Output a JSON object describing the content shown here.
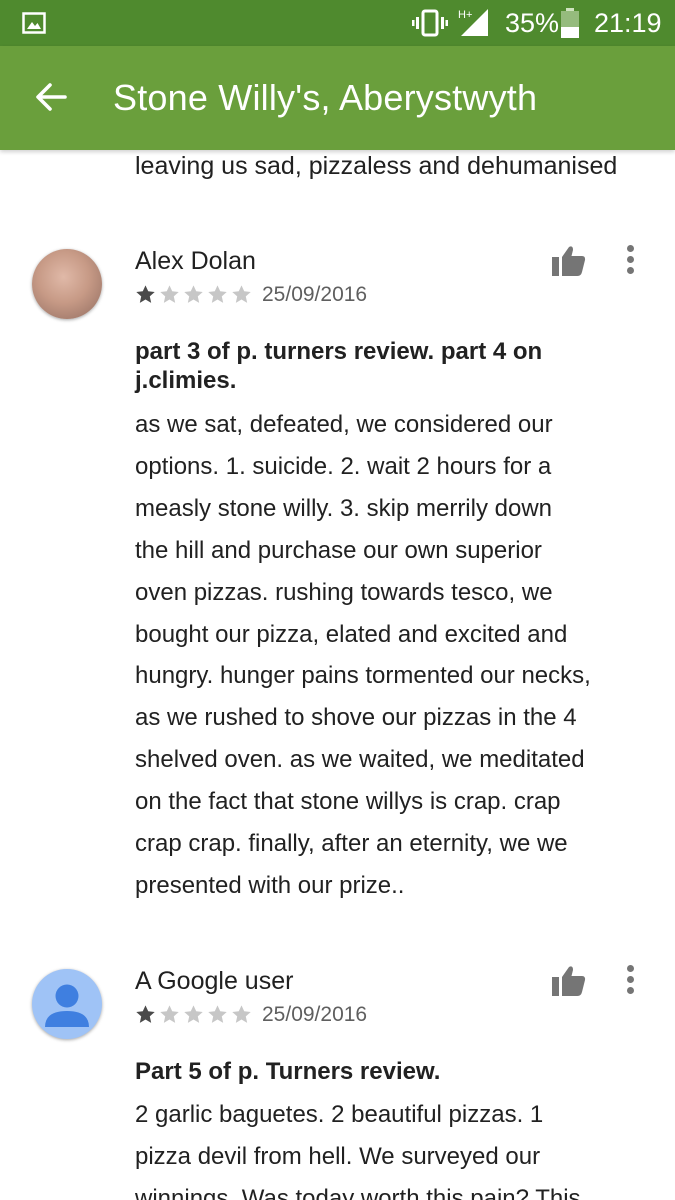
{
  "status_bar": {
    "network": "H+",
    "battery": "35%",
    "time": "21:19"
  },
  "app_bar": {
    "title": "Stone Willy's, Aberystwyth"
  },
  "previous_review_tail": "leaving us sad, pizzaless and dehumanised",
  "reviews": [
    {
      "author": "Alex Dolan",
      "rating": 1,
      "max_rating": 5,
      "date": "25/09/2016",
      "title_lines": [
        "part 3 of p. turners review. part 4 on",
        "j.climies."
      ],
      "body_lines": [
        "as we sat, defeated, we considered our",
        "options. 1. suicide. 2. wait 2 hours for a",
        "measly stone willy. 3. skip merrily down",
        "the hill and purchase our own superior",
        "oven pizzas. rushing towards tesco, we",
        "bought our pizza, elated and excited and",
        "hungry. hunger pains tormented our necks,",
        "as we rushed to shove our pizzas in the 4",
        "shelved oven. as we waited, we meditated",
        "on the fact that stone willys is crap. crap",
        "crap crap. finally, after an eternity, we we",
        "presented with our prize.."
      ]
    },
    {
      "author": "A Google user",
      "rating": 1,
      "max_rating": 5,
      "date": "25/09/2016",
      "title_lines": [
        "Part 5 of p. Turners review."
      ],
      "body_lines": [
        "2 garlic baguetes. 2 beautiful pizzas. 1",
        "pizza devil from hell. We surveyed our",
        "winnings. Was today worth this pain? This"
      ]
    }
  ],
  "colors": {
    "status_bar": "#4f8a2e",
    "app_bar": "#6a9f3c",
    "star_filled": "#4a4a4a",
    "star_empty": "#c7c7c7"
  }
}
